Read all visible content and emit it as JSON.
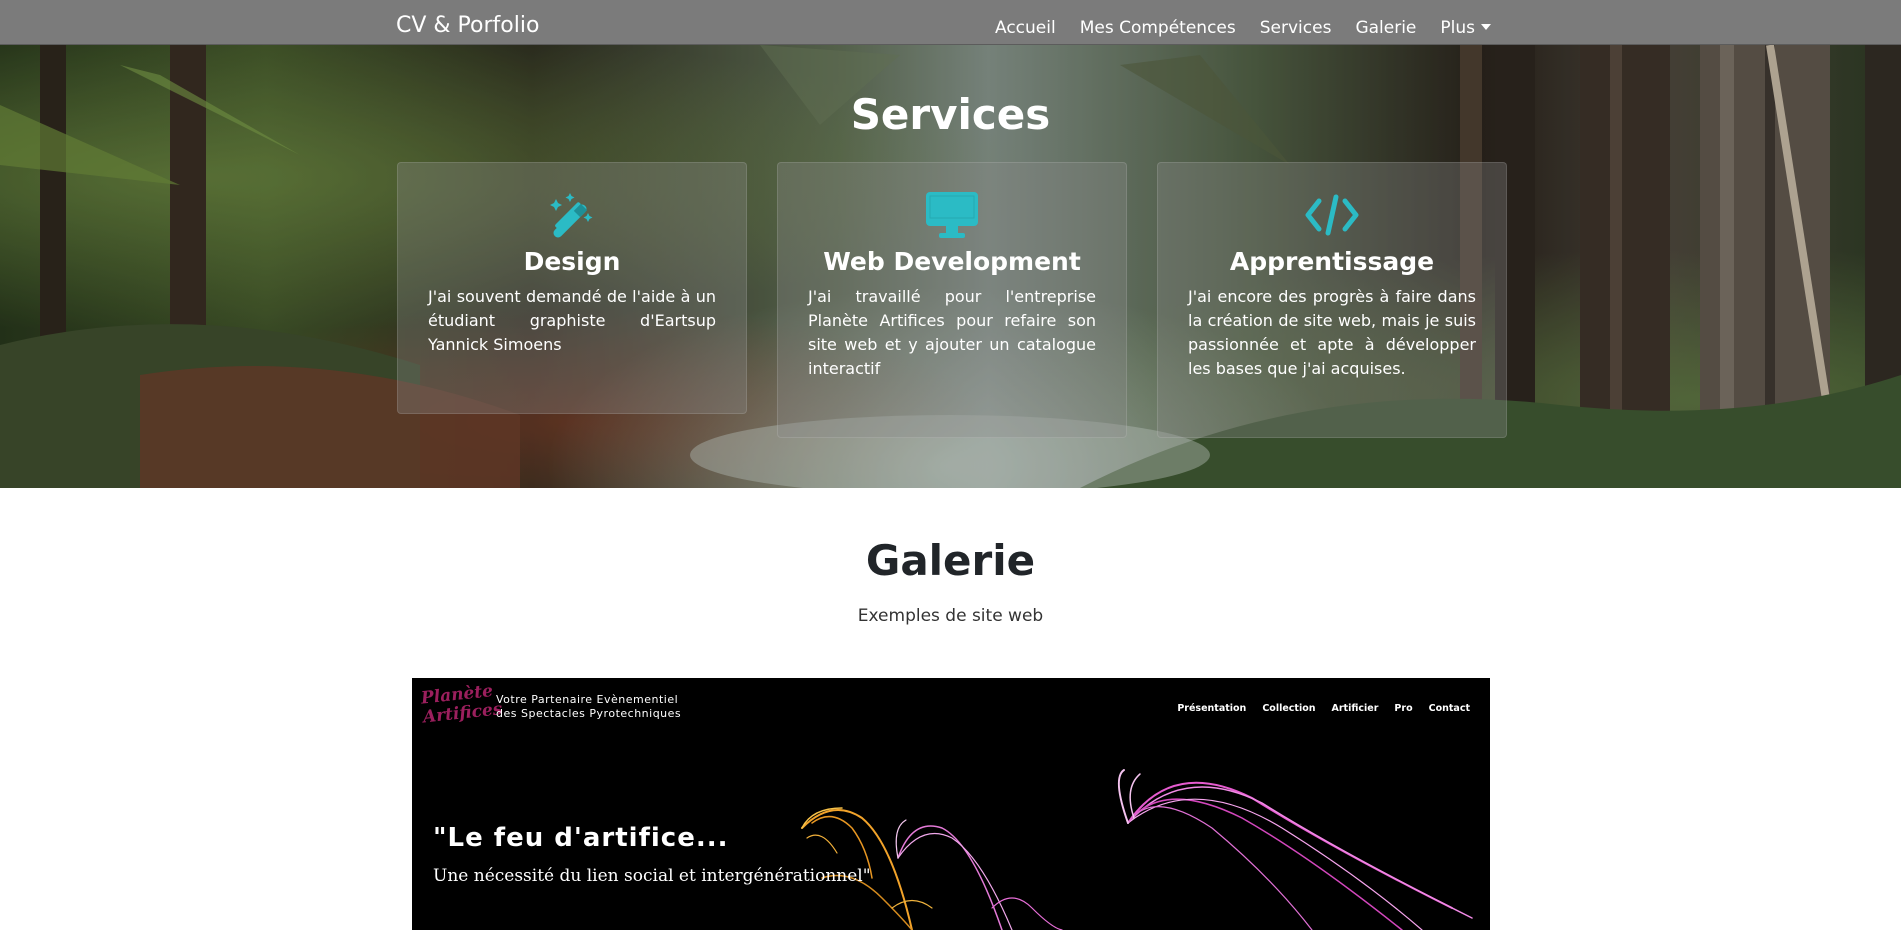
{
  "navbar": {
    "brand": "CV & Porfolio",
    "links": [
      "Accueil",
      "Mes Compétences",
      "Services",
      "Galerie",
      "Plus"
    ],
    "bg_color": "#7b7b7b"
  },
  "services": {
    "title": "Services",
    "accent_color": "#2bbbc5",
    "cards": [
      {
        "icon": "magic-wand-icon",
        "title": "Design",
        "text": "J'ai souvent demandé de l'aide à un étudiant graphiste d'Eartsup Yannick Simoens"
      },
      {
        "icon": "desktop-icon",
        "title": "Web Development",
        "text": "J'ai travaillé pour l'entreprise Planète Artifices pour refaire son site web et y ajouter un catalogue interactif"
      },
      {
        "icon": "code-icon",
        "title": "Apprentissage",
        "text": "J'ai encore des progrès à faire dans la création de site web, mais je suis passionnée et apte à développer les bases que j'ai acquises."
      }
    ]
  },
  "gallery": {
    "title": "Galerie",
    "subtitle": "Exemples de site web",
    "screenshot": {
      "logo_line1": "Planète",
      "logo_line2": "Artifices",
      "tagline_line1": "Votre Partenaire Evènementiel",
      "tagline_line2": "des Spectacles Pyrotechniques",
      "nav": [
        "Présentation",
        "Collection",
        "Artificier",
        "Pro",
        "Contact"
      ],
      "quote": "\"Le feu d'artifice...",
      "subquote": "Une nécessité du lien social et intergénérationnel\"",
      "logo_color": "#9b1f5d"
    }
  }
}
